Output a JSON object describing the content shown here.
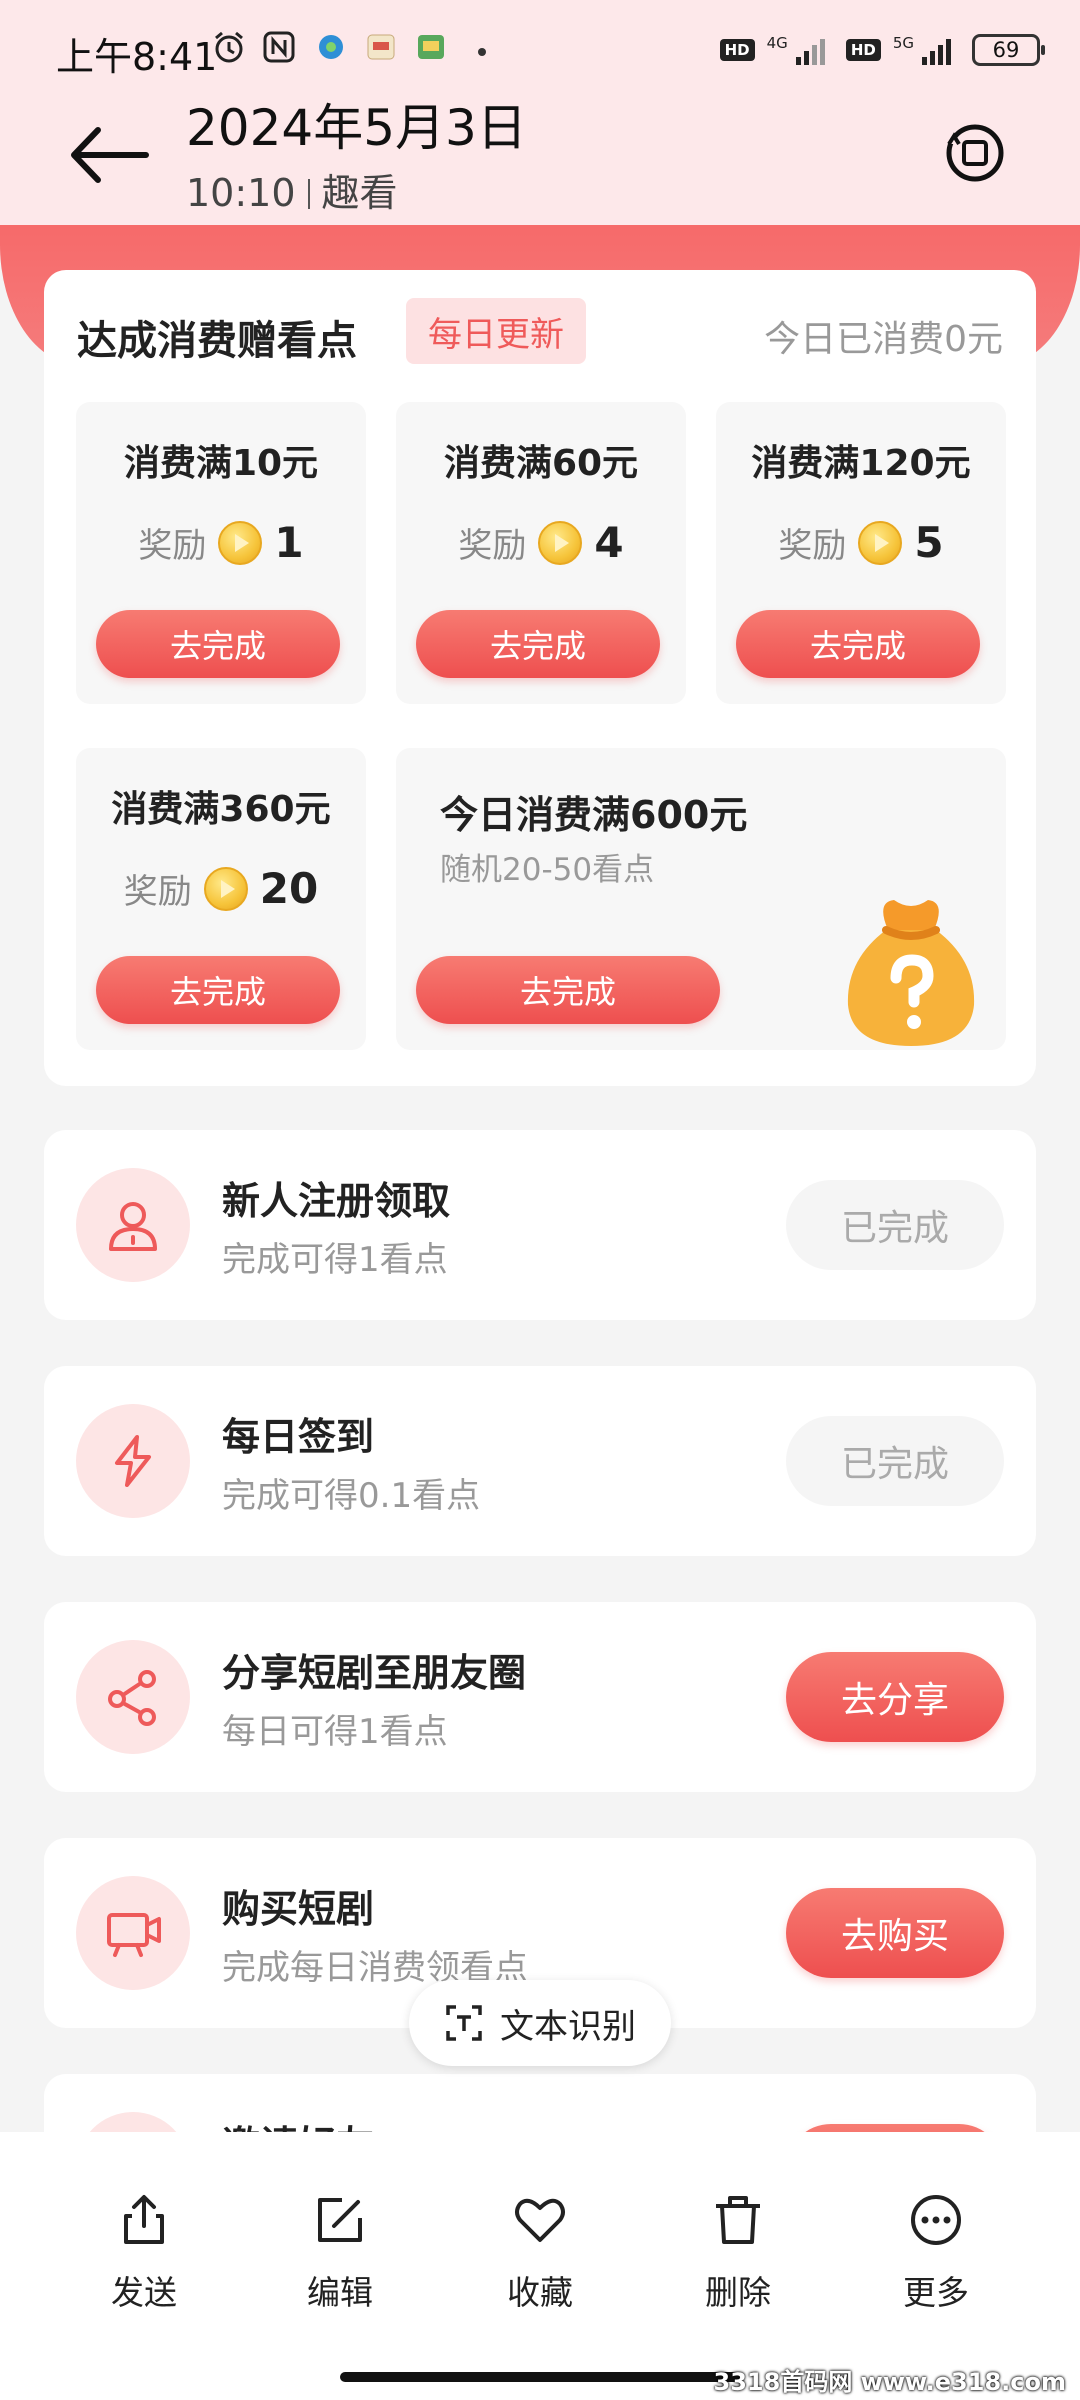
{
  "status_bar": {
    "time": "上午8:41",
    "hd": "HD",
    "net_4g": "4G",
    "net_5g": "5G",
    "battery": "69"
  },
  "header": {
    "title": "2024年5月3日",
    "time": "10:10",
    "source": "趣看"
  },
  "consume": {
    "title": "达成消费赠看点",
    "badge": "每日更新",
    "today": "今日已消费0元",
    "reward_label": "奖励",
    "tiers": [
      {
        "name": "消费满10元",
        "reward": "1",
        "button": "去完成"
      },
      {
        "name": "消费满60元",
        "reward": "4",
        "button": "去完成"
      },
      {
        "name": "消费满120元",
        "reward": "5",
        "button": "去完成"
      },
      {
        "name": "消费满360元",
        "reward": "20",
        "button": "去完成"
      }
    ],
    "big": {
      "name": "今日消费满600元",
      "sub": "随机20-50看点",
      "button": "去完成"
    }
  },
  "tasks": [
    {
      "title": "新人注册领取",
      "sub": "完成可得1看点",
      "button": "已完成",
      "icon": "user-icon"
    },
    {
      "title": "每日签到",
      "sub": "完成可得0.1看点",
      "button": "已完成",
      "icon": "lightning-icon"
    },
    {
      "title": "分享短剧至朋友圈",
      "sub": "每日可得1看点",
      "button": "去分享",
      "icon": "share-icon"
    },
    {
      "title": "购买短剧",
      "sub": "完成每日消费领看点",
      "button": "去购买",
      "icon": "video-icon"
    },
    {
      "title": "邀请好友",
      "sub": "",
      "button": "",
      "icon": "invite-icon"
    }
  ],
  "ocr_label": "文本识别",
  "toolbar": {
    "send": "发送",
    "edit": "编辑",
    "favorite": "收藏",
    "delete": "删除",
    "more": "更多"
  },
  "watermark": "3318首码网 www.e318.com",
  "colors": {
    "accent": "#ee4f4f",
    "header_bg": "#fde8ea",
    "page_bg": "#f4f4f4"
  }
}
